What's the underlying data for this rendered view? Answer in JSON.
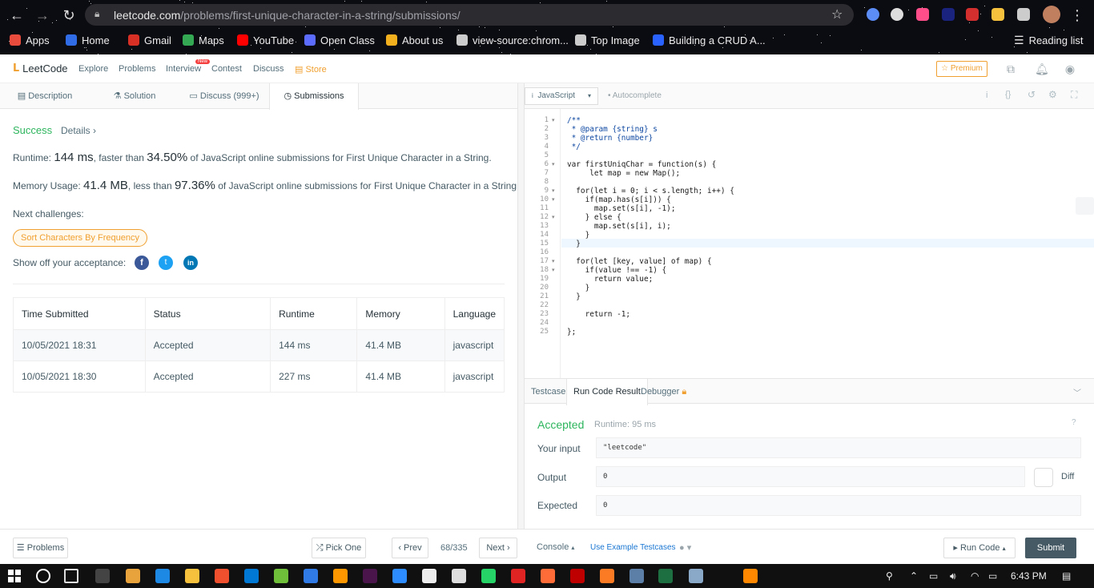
{
  "browser": {
    "url_domain": "leetcode.com",
    "url_path": "/problems/first-unique-character-in-a-string/submissions/",
    "bookmarks": [
      {
        "label": "Apps",
        "icon": "apps-grid-icon",
        "color": "#e94b3c"
      },
      {
        "label": "Home",
        "icon": "home-icon",
        "color": "#2f6ce5"
      },
      {
        "label": "Gmail",
        "icon": "gmail-icon",
        "color": "#d93025"
      },
      {
        "label": "Maps",
        "icon": "maps-icon",
        "color": "#34a853"
      },
      {
        "label": "YouTube",
        "icon": "youtube-icon",
        "color": "#ff0000"
      },
      {
        "label": "Open Class",
        "icon": "open-class-icon",
        "color": "#5b6cff"
      },
      {
        "label": "About us",
        "icon": "about-us-icon",
        "color": "#f2b01e"
      },
      {
        "label": "view-source:chrom...",
        "icon": "globe-icon",
        "color": "#cccccc"
      },
      {
        "label": "Top Image",
        "icon": "globe-icon",
        "color": "#cccccc"
      },
      {
        "label": "Building a CRUD A...",
        "icon": "crud-icon",
        "color": "#2962ff"
      }
    ],
    "reading_list": "Reading list"
  },
  "lc_nav": {
    "brand": "LeetCode",
    "links": [
      "Explore",
      "Problems",
      "Interview",
      "Contest",
      "Discuss"
    ],
    "new_badge": "New",
    "store": "Store",
    "premium": "Premium"
  },
  "left_tabs": [
    "Description",
    "Solution",
    "Discuss (999+)",
    "Submissions"
  ],
  "result": {
    "status": "Success",
    "details": "Details",
    "runtime_label": "Runtime:",
    "runtime_value": "144 ms",
    "runtime_mid": ", faster than",
    "runtime_pct": "34.50%",
    "runtime_tail": "of JavaScript online submissions for First Unique Character in a String.",
    "memory_label": "Memory Usage:",
    "memory_value": "41.4 MB",
    "memory_mid": ", less than",
    "memory_pct": "97.36%",
    "memory_tail": "of JavaScript online submissions for First Unique Character in a String.",
    "next_challenges": "Next challenges:",
    "challenge": "Sort Characters By Frequency",
    "share": "Show off your acceptance:"
  },
  "submissions_table": {
    "headers": [
      "Time Submitted",
      "Status",
      "Runtime",
      "Memory",
      "Language"
    ],
    "rows": [
      [
        "10/05/2021 18:31",
        "Accepted",
        "144 ms",
        "41.4 MB",
        "javascript"
      ],
      [
        "10/05/2021 18:30",
        "Accepted",
        "227 ms",
        "41.4 MB",
        "javascript"
      ]
    ]
  },
  "editor": {
    "language": "JavaScript",
    "autocomplete": "Autocomplete",
    "lines": [
      "/**",
      " * @param {string} s",
      " * @return {number}",
      " */",
      "",
      "var firstUniqChar = function(s) {",
      "     let map = new Map();",
      "",
      "  for(let i = 0; i < s.length; i++) {",
      "    if(map.has(s[i])) {",
      "      map.set(s[i], -1);",
      "    } else {",
      "      map.set(s[i], i);",
      "    }",
      "  }",
      "",
      "  for(let [key, value] of map) {",
      "    if(value !== -1) {",
      "      return value;",
      "    }",
      "  }",
      "",
      "    return -1;",
      "",
      "};"
    ]
  },
  "result_panel": {
    "tabs": [
      "Testcase",
      "Run Code Result",
      "Debugger"
    ],
    "status": "Accepted",
    "runtime": "Runtime: 95 ms",
    "your_input_label": "Your input",
    "your_input": "\"leetcode\"",
    "output_label": "Output",
    "output": "0",
    "expected_label": "Expected",
    "expected": "0",
    "diff": "Diff"
  },
  "footer": {
    "problems": "Problems",
    "pick_one": "Pick One",
    "prev": "Prev",
    "page": "68/335",
    "next": "Next",
    "console": "Console",
    "use_example": "Use Example Testcases",
    "run_code": "Run Code",
    "submit": "Submit"
  },
  "taskbar": {
    "time": "6:43 PM"
  },
  "colors": {
    "success": "#2db55d",
    "premium": "#f0a030",
    "submit_bg": "#455a64"
  }
}
